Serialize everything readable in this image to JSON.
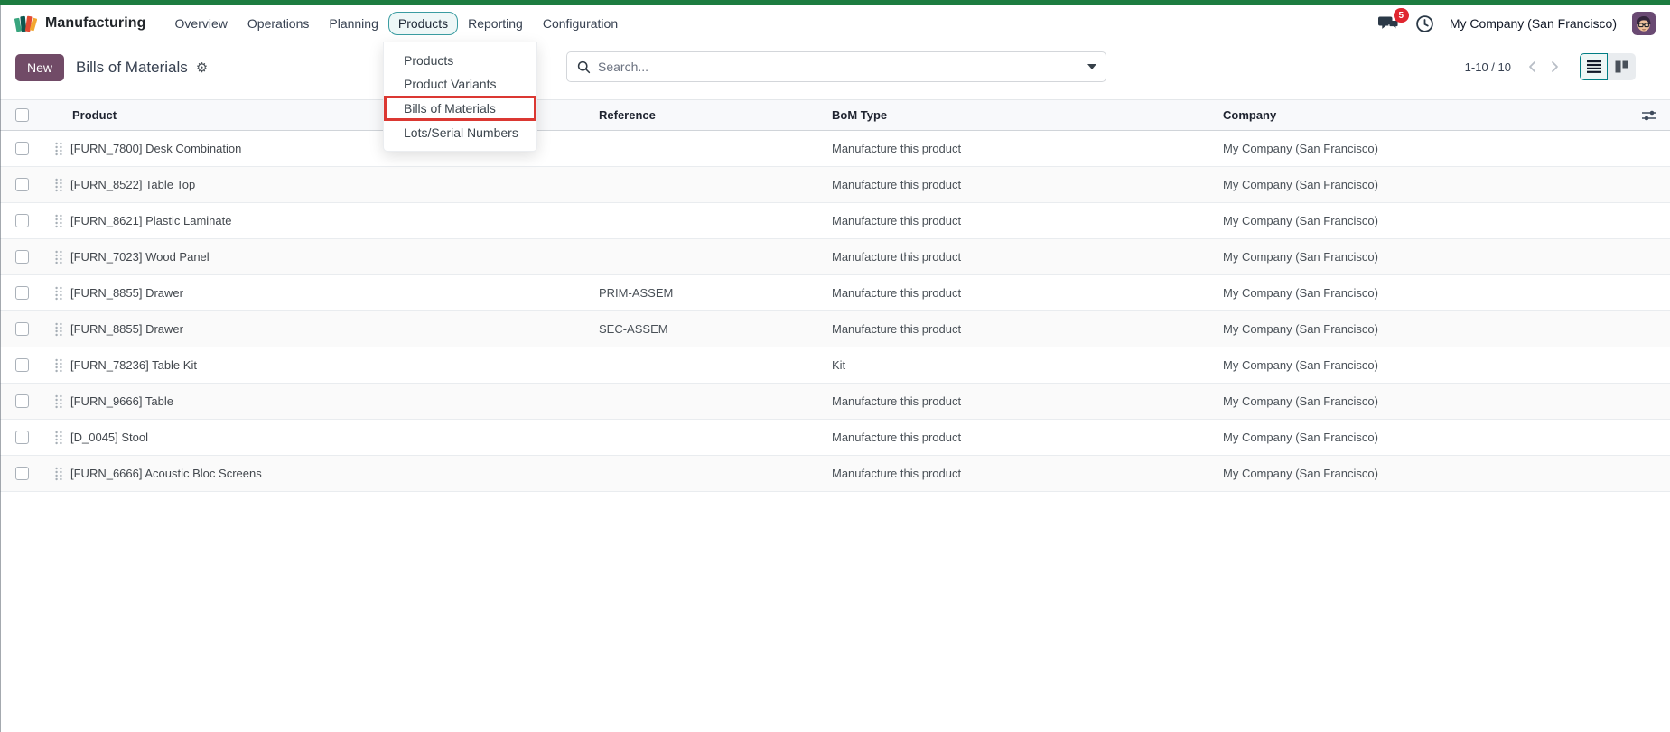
{
  "nav": {
    "app_name": "Manufacturing",
    "items": [
      {
        "label": "Overview"
      },
      {
        "label": "Operations"
      },
      {
        "label": "Planning"
      },
      {
        "label": "Products",
        "active": true
      },
      {
        "label": "Reporting"
      },
      {
        "label": "Configuration"
      }
    ],
    "systray": {
      "message_count": "5",
      "company": "My Company (San Francisco)"
    }
  },
  "products_menu": {
    "items": [
      "Products",
      "Product Variants",
      "Bills of Materials",
      "Lots/Serial Numbers"
    ],
    "highlighted_item": "Bills of Materials"
  },
  "control_panel": {
    "new_button_label": "New",
    "title": "Bills of Materials",
    "search_placeholder": "Search...",
    "pager_value": "1-10 / 10"
  },
  "table": {
    "columns": [
      "Product",
      "Reference",
      "BoM Type",
      "Company"
    ],
    "rows": [
      {
        "product": "[FURN_7800] Desk Combination",
        "reference": "",
        "bom_type": "Manufacture this product",
        "company": "My Company (San Francisco)"
      },
      {
        "product": "[FURN_8522] Table Top",
        "reference": "",
        "bom_type": "Manufacture this product",
        "company": "My Company (San Francisco)"
      },
      {
        "product": "[FURN_8621] Plastic Laminate",
        "reference": "",
        "bom_type": "Manufacture this product",
        "company": "My Company (San Francisco)"
      },
      {
        "product": "[FURN_7023] Wood Panel",
        "reference": "",
        "bom_type": "Manufacture this product",
        "company": "My Company (San Francisco)"
      },
      {
        "product": "[FURN_8855] Drawer",
        "reference": "PRIM-ASSEM",
        "bom_type": "Manufacture this product",
        "company": "My Company (San Francisco)"
      },
      {
        "product": "[FURN_8855] Drawer",
        "reference": "SEC-ASSEM",
        "bom_type": "Manufacture this product",
        "company": "My Company (San Francisco)"
      },
      {
        "product": "[FURN_78236] Table Kit",
        "reference": "",
        "bom_type": "Kit",
        "company": "My Company (San Francisco)"
      },
      {
        "product": "[FURN_9666] Table",
        "reference": "",
        "bom_type": "Manufacture this product",
        "company": "My Company (San Francisco)"
      },
      {
        "product": "[D_0045] Stool",
        "reference": "",
        "bom_type": "Manufacture this product",
        "company": "My Company (San Francisco)"
      },
      {
        "product": "[FURN_6666] Acoustic Bloc Screens",
        "reference": "",
        "bom_type": "Manufacture this product",
        "company": "My Company (San Francisco)"
      }
    ]
  },
  "icons": {
    "app_logo": "manufacturing-logo",
    "messages": "chat-bubbles",
    "activities": "clock",
    "user": "avatar",
    "title_settings": "gear",
    "search": "magnifier",
    "search_expand": "caret-down",
    "pager_previous": "chevron-left",
    "pager_next": "chevron-right",
    "view_list": "list-lines",
    "view_kanban": "kanban-columns",
    "row_drag": "dot-grid-handle",
    "optional_columns": "column-sliders"
  },
  "colors": {
    "top_bar": "#1d7c40",
    "primary_button": "#714B67",
    "active_menu_outline": "#3a9ca1",
    "notification_badge": "#e0262f",
    "tutorial_highlight": "#db3832",
    "view_switch_active": "#017e84"
  }
}
